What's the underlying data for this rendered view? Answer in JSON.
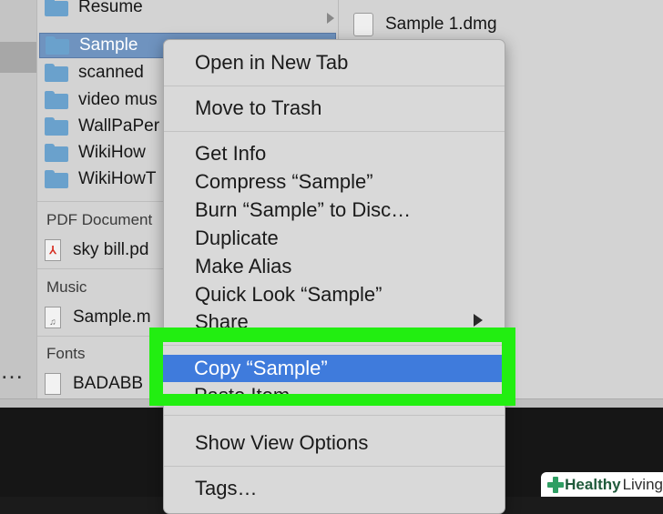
{
  "finder": {
    "list": [
      {
        "name": "Resume",
        "has_arrow": true
      },
      {
        "name": "Sample",
        "selected": true
      },
      {
        "name": "scanned"
      },
      {
        "name": "video mus"
      },
      {
        "name": "WallPaPer"
      },
      {
        "name": "WikiHow"
      },
      {
        "name": "WikiHowT"
      }
    ],
    "sections": {
      "pdf": {
        "label": "PDF Document",
        "file": "sky bill.pd"
      },
      "music": {
        "label": "Music",
        "file": "Sample.m"
      },
      "fonts": {
        "label": "Fonts",
        "file": "BADABB"
      }
    },
    "preview": {
      "file": "Sample 1.dmg"
    },
    "sidebar_dots": "…"
  },
  "context_menu": {
    "items": {
      "open_new_tab": "Open in New Tab",
      "move_to_trash": "Move to Trash",
      "get_info": "Get Info",
      "compress": "Compress “Sample”",
      "burn": "Burn “Sample” to Disc…",
      "duplicate": "Duplicate",
      "make_alias": "Make Alias",
      "quick_look": "Quick Look “Sample”",
      "share": "Share",
      "copy": "Copy “Sample”",
      "paste_item": "Paste Item",
      "show_view_options": "Show View Options",
      "tags": "Tags…"
    },
    "highlighted": "copy"
  },
  "colors": {
    "highlight_frame": "#22ee11",
    "menu_selection": "#3f7bdc",
    "folder": "#6aa1cc"
  },
  "watermark": {
    "bold": "Healthy",
    "rest": "Living"
  }
}
